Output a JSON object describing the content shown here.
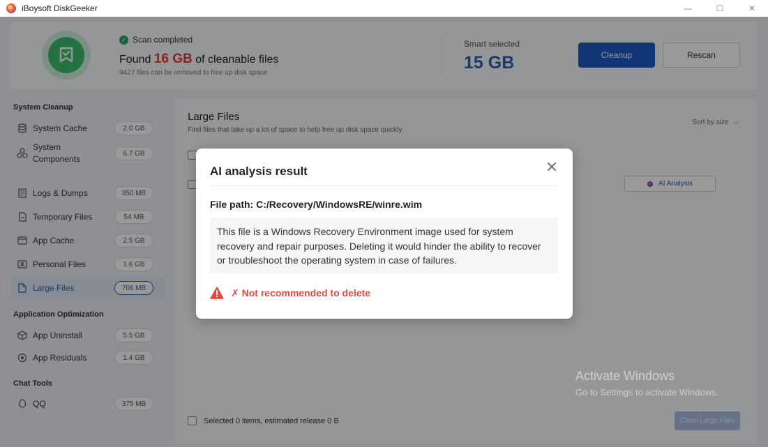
{
  "window": {
    "title": "iBoysoft DiskGeeker",
    "minimize_glyph": "—",
    "maximize_glyph": "☐",
    "close_glyph": "✕"
  },
  "header": {
    "scan_status": "Scan completed",
    "found_prefix": "Found",
    "found_amount": "16 GB",
    "found_suffix": "of cleanable files",
    "files_note": "9427 files can be removed to free up disk space",
    "smart_label": "Smart selected",
    "smart_value": "15 GB",
    "cleanup_label": "Cleanup",
    "rescan_label": "Rescan"
  },
  "sidebar": {
    "sections": [
      {
        "title": "System Cleanup",
        "items": [
          {
            "label": "System Cache",
            "size": "2.0 GB",
            "icon": "database-icon"
          },
          {
            "label": "System Components",
            "size": "6.7 GB",
            "icon": "components-icon"
          },
          {
            "label": "Logs & Dumps",
            "size": "350 MB",
            "icon": "log-icon"
          },
          {
            "label": "Temporary Files",
            "size": "54 MB",
            "icon": "temp-file-icon"
          },
          {
            "label": "App Cache",
            "size": "2.5 GB",
            "icon": "app-cache-icon"
          },
          {
            "label": "Personal Files",
            "size": "1.6 GB",
            "icon": "personal-files-icon"
          },
          {
            "label": "Large Files",
            "size": "706 MB",
            "icon": "large-files-icon",
            "active": true
          }
        ]
      },
      {
        "title": "Application Optimization",
        "items": [
          {
            "label": "App Uninstall",
            "size": "5.5 GB",
            "icon": "uninstall-icon"
          },
          {
            "label": "App Residuals",
            "size": "1.4 GB",
            "icon": "residuals-icon"
          }
        ]
      },
      {
        "title": "Chat Tools",
        "items": [
          {
            "label": "QQ",
            "size": "375 MB",
            "icon": "qq-icon"
          }
        ]
      }
    ]
  },
  "main": {
    "title": "Large Files",
    "subtitle": "Find files that take up a lot of space to help free up disk space quickly.",
    "sort_label": "Sort by size",
    "ai_button": "AI Analysis",
    "footer_text": "Selected 0 items, estimated release 0 B",
    "clean_button": "Clean Large Files"
  },
  "dialog": {
    "title": "AI analysis result",
    "file_path": "File path: C:/Recovery/WindowsRE/winre.wim",
    "description": "This file is a Windows Recovery Environment image used for system recovery and repair purposes. Deleting it would hinder the ability to recover or troubleshoot the operating system in case of failures.",
    "warning": "✗ Not recommended to delete",
    "warning_color": "#e14b3f"
  },
  "watermark": {
    "title": "Activate Windows",
    "subtitle": "Go to Settings to activate Windows."
  },
  "colors": {
    "accent": "#1f59c4",
    "found_red": "#e03b3b",
    "success_green": "#3cbf6e"
  }
}
